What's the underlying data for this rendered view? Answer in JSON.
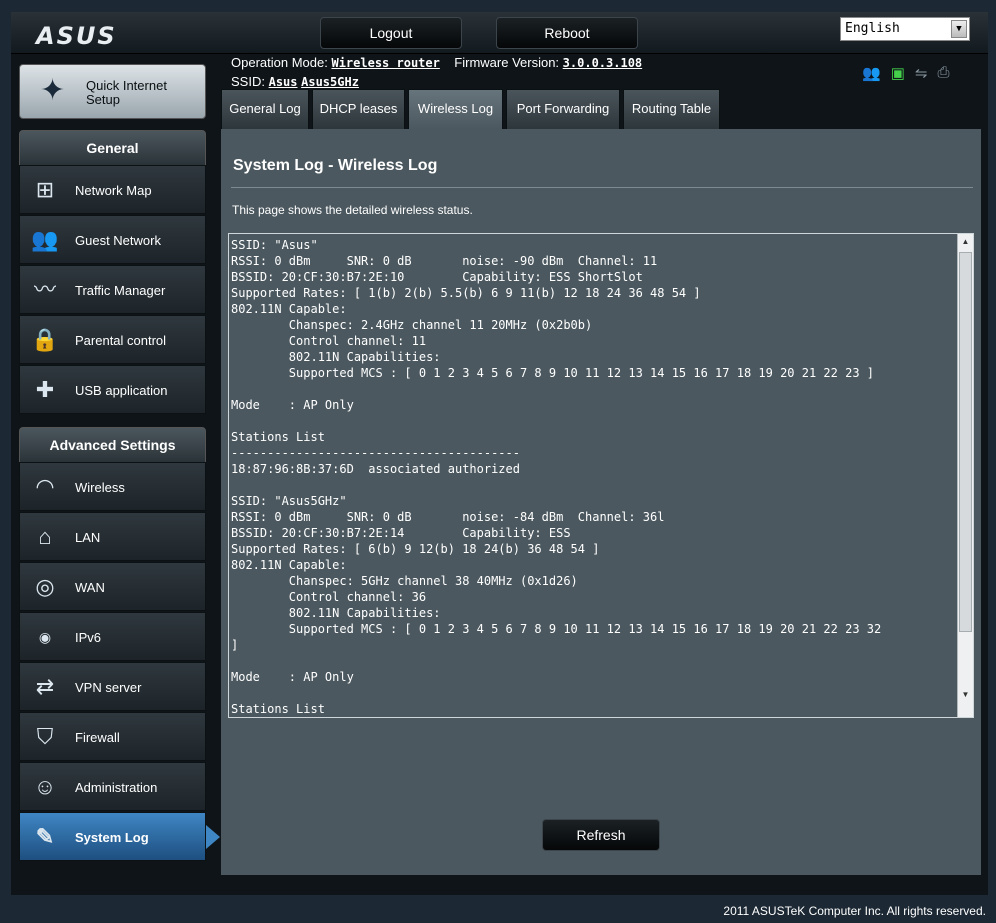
{
  "brand": "ASUS",
  "header": {
    "logout_label": "Logout",
    "reboot_label": "Reboot",
    "language": "English"
  },
  "info": {
    "op_mode_label": "Operation Mode:",
    "op_mode_value": "Wireless router",
    "fw_label": "Firmware Version:",
    "fw_value": "3.0.0.3.108",
    "ssid_label": "SSID:",
    "ssid_1": "Asus",
    "ssid_2": "Asus5GHz"
  },
  "status_icons": [
    "clients-icon",
    "network-icon",
    "usb-icon",
    "printer-icon"
  ],
  "sidebar": {
    "qis_label": "Quick Internet Setup",
    "general_title": "General",
    "general_items": [
      {
        "label": "Network Map",
        "icon": "network-map-icon"
      },
      {
        "label": "Guest Network",
        "icon": "guest-network-icon"
      },
      {
        "label": "Traffic Manager",
        "icon": "traffic-manager-icon"
      },
      {
        "label": "Parental control",
        "icon": "lock-icon"
      },
      {
        "label": "USB application",
        "icon": "puzzle-icon"
      }
    ],
    "advanced_title": "Advanced Settings",
    "advanced_items": [
      {
        "label": "Wireless",
        "icon": "wifi-icon"
      },
      {
        "label": "LAN",
        "icon": "home-icon"
      },
      {
        "label": "WAN",
        "icon": "globe-icon"
      },
      {
        "label": "IPv6",
        "icon": "ipv6-icon"
      },
      {
        "label": "VPN server",
        "icon": "vpn-icon"
      },
      {
        "label": "Firewall",
        "icon": "shield-icon"
      },
      {
        "label": "Administration",
        "icon": "user-icon"
      },
      {
        "label": "System Log",
        "icon": "log-icon"
      }
    ]
  },
  "tabs": [
    {
      "label": "General Log"
    },
    {
      "label": "DHCP leases"
    },
    {
      "label": "Wireless Log"
    },
    {
      "label": "Port Forwarding"
    },
    {
      "label": "Routing Table"
    }
  ],
  "main": {
    "title": "System Log - Wireless Log",
    "description": "This page shows the detailed wireless status.",
    "log_text": "SSID: \"Asus\"\nRSSI: 0 dBm     SNR: 0 dB       noise: -90 dBm  Channel: 11\nBSSID: 20:CF:30:B7:2E:10        Capability: ESS ShortSlot\nSupported Rates: [ 1(b) 2(b) 5.5(b) 6 9 11(b) 12 18 24 36 48 54 ]\n802.11N Capable:\n        Chanspec: 2.4GHz channel 11 20MHz (0x2b0b)\n        Control channel: 11\n        802.11N Capabilities:\n        Supported MCS : [ 0 1 2 3 4 5 6 7 8 9 10 11 12 13 14 15 16 17 18 19 20 21 22 23 ]\n\nMode    : AP Only\n\nStations List\n----------------------------------------\n18:87:96:8B:37:6D  associated authorized\n\nSSID: \"Asus5GHz\"\nRSSI: 0 dBm     SNR: 0 dB       noise: -84 dBm  Channel: 36l\nBSSID: 20:CF:30:B7:2E:14        Capability: ESS\nSupported Rates: [ 6(b) 9 12(b) 18 24(b) 36 48 54 ]\n802.11N Capable:\n        Chanspec: 5GHz channel 38 40MHz (0x1d26)\n        Control channel: 36\n        802.11N Capabilities:\n        Supported MCS : [ 0 1 2 3 4 5 6 7 8 9 10 11 12 13 14 15 16 17 18 19 20 21 22 23 32\n]\n\nMode    : AP Only\n\nStations List",
    "refresh_label": "Refresh"
  },
  "footer": "2011 ASUSTeK Computer Inc. All rights reserved."
}
